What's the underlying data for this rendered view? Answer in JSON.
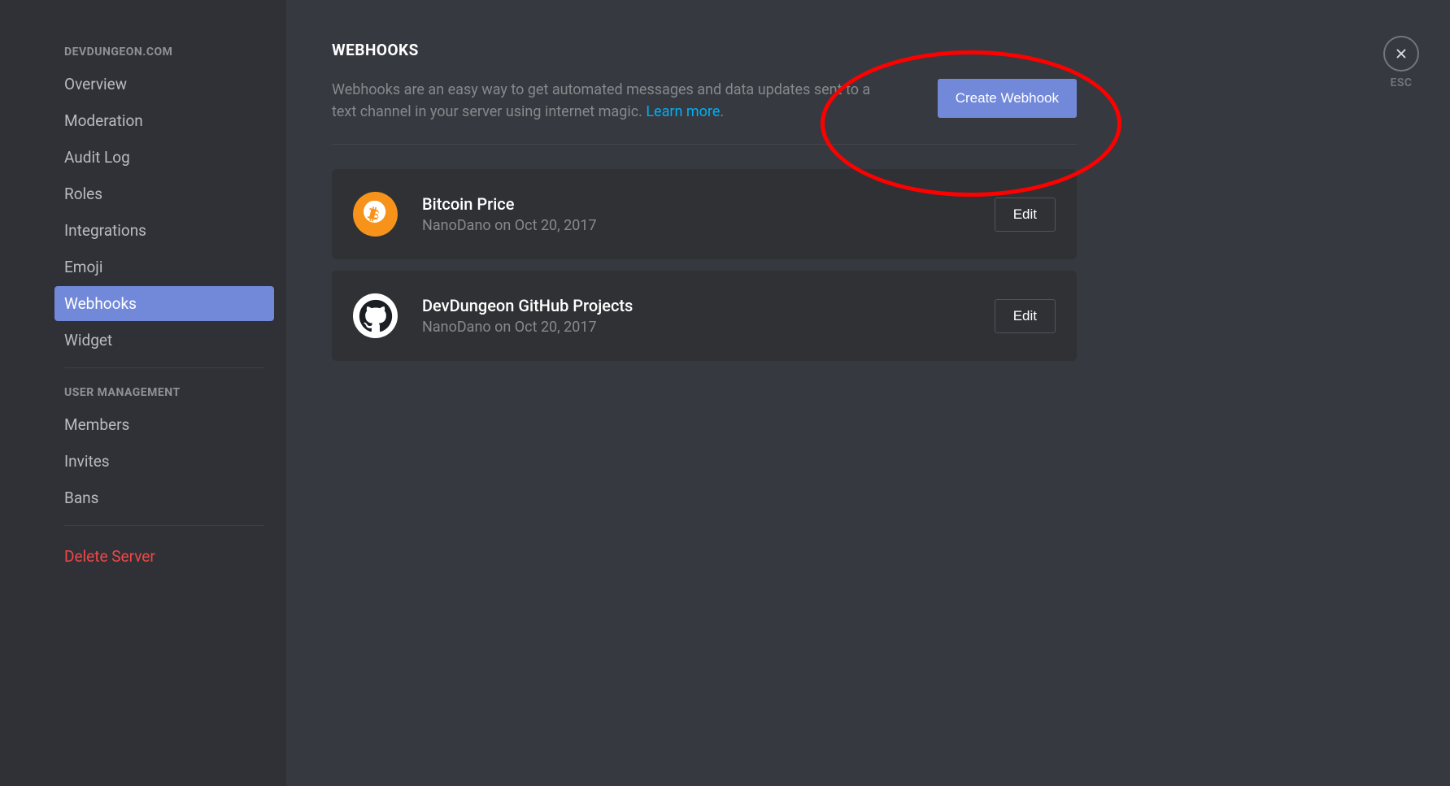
{
  "sidebar": {
    "section1_header": "DEVDUNGEON.COM",
    "items1": [
      {
        "label": "Overview",
        "active": false
      },
      {
        "label": "Moderation",
        "active": false
      },
      {
        "label": "Audit Log",
        "active": false
      },
      {
        "label": "Roles",
        "active": false
      },
      {
        "label": "Integrations",
        "active": false
      },
      {
        "label": "Emoji",
        "active": false
      },
      {
        "label": "Webhooks",
        "active": true
      },
      {
        "label": "Widget",
        "active": false
      }
    ],
    "section2_header": "USER MANAGEMENT",
    "items2": [
      {
        "label": "Members"
      },
      {
        "label": "Invites"
      },
      {
        "label": "Bans"
      }
    ],
    "delete_label": "Delete Server"
  },
  "main": {
    "title": "WEBHOOKS",
    "description_part1": "Webhooks are an easy way to get automated messages and data updates sent to a text channel in your server using internet magic. ",
    "learn_more": "Learn more",
    "description_part2": ".",
    "create_button": "Create Webhook",
    "close_label": "ESC",
    "webhooks": [
      {
        "name": "Bitcoin Price",
        "meta": "NanoDano on Oct 20, 2017",
        "icon": "bitcoin",
        "edit_label": "Edit"
      },
      {
        "name": "DevDungeon GitHub Projects",
        "meta": "NanoDano on Oct 20, 2017",
        "icon": "github",
        "edit_label": "Edit"
      }
    ]
  }
}
